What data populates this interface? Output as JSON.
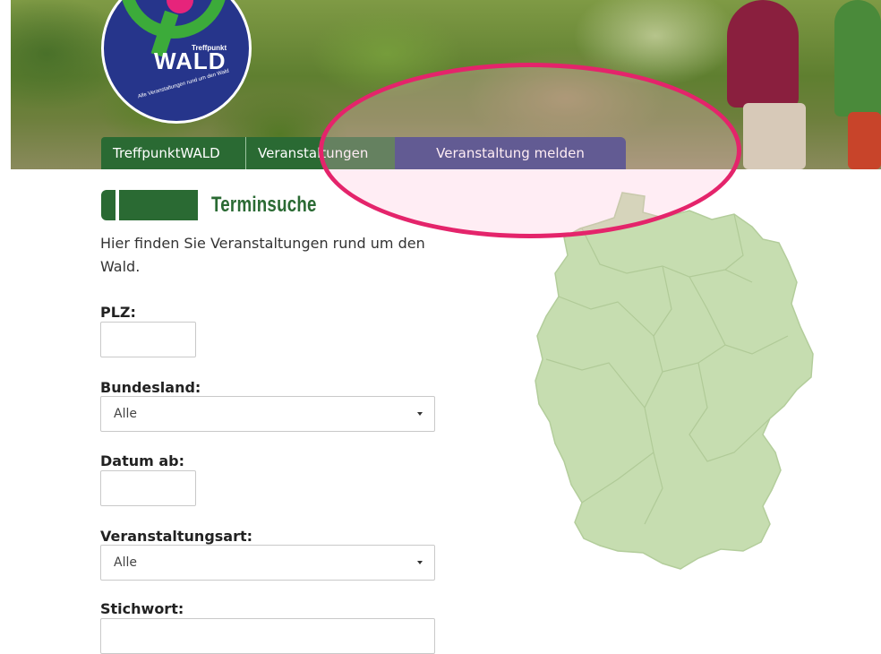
{
  "logo": {
    "small_text": "Treffpunkt",
    "big_text": "WALD",
    "claim": "Alle Veranstaltungen rund um den Wald"
  },
  "nav": {
    "items": [
      {
        "label": "TreffpunktWALD"
      },
      {
        "label": "Veranstaltungen"
      },
      {
        "label": "Veranstaltung melden"
      }
    ]
  },
  "colors": {
    "green": "#2a6a33",
    "blue": "#263579",
    "highlight": "#e4246b",
    "map": "#c6ddb0"
  },
  "main": {
    "title": "Terminsuche",
    "intro": "Hier finden Sie Veranstaltungen rund um den Wald."
  },
  "form": {
    "plz_label": "PLZ:",
    "plz_value": "",
    "bundesland_label": "Bundesland:",
    "bundesland_value": "Alle",
    "datum_label": "Datum ab:",
    "datum_value": "",
    "art_label": "Veranstaltungsart:",
    "art_value": "Alle",
    "stichwort_label": "Stichwort:",
    "stichwort_value": ""
  }
}
